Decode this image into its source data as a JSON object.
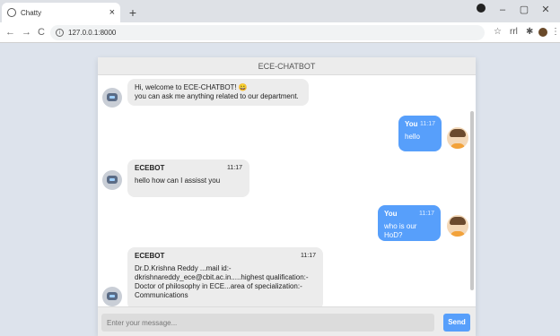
{
  "browser": {
    "tab_title": "Chatty",
    "tab_close": "×",
    "new_tab": "+",
    "url": "127.0.0.1:8000",
    "nav_back": "←",
    "nav_forward": "→",
    "nav_reload": "C",
    "star": "☆",
    "ext_text": "rrl",
    "menu": "⋮",
    "win_min": "–",
    "win_max": "▢",
    "win_close": "✕"
  },
  "chat": {
    "header_title": "ECE-CHATBOT",
    "messages": [
      {
        "sender": "bot",
        "lines": [
          "Hi, welcome to ECE-CHATBOT! 😀",
          "you can ask me anything related to our department."
        ]
      },
      {
        "sender": "user",
        "name": "You",
        "time": "11:17",
        "text": "hello"
      },
      {
        "sender": "bot",
        "name": "ECEBOT",
        "time": "11:17",
        "text": "hello how can I assisst you"
      },
      {
        "sender": "user",
        "name": "You",
        "time": "11:17",
        "text": "who is our HoD?"
      },
      {
        "sender": "bot",
        "name": "ECEBOT",
        "time": "11:17",
        "lines": [
          "Dr.D.Krishna Reddy ...mail id:-",
          "dkrishnareddy_ece@cbit.ac.in.....highest qualification:-",
          "Doctor of philosophy in ECE...area of specialization:-",
          "Communications"
        ]
      }
    ],
    "input_placeholder": "Enter your message...",
    "send_label": "Send"
  },
  "colors": {
    "accent": "#579ffb",
    "bot_bubble": "#ececec",
    "page_bg": "#dde3ec"
  }
}
